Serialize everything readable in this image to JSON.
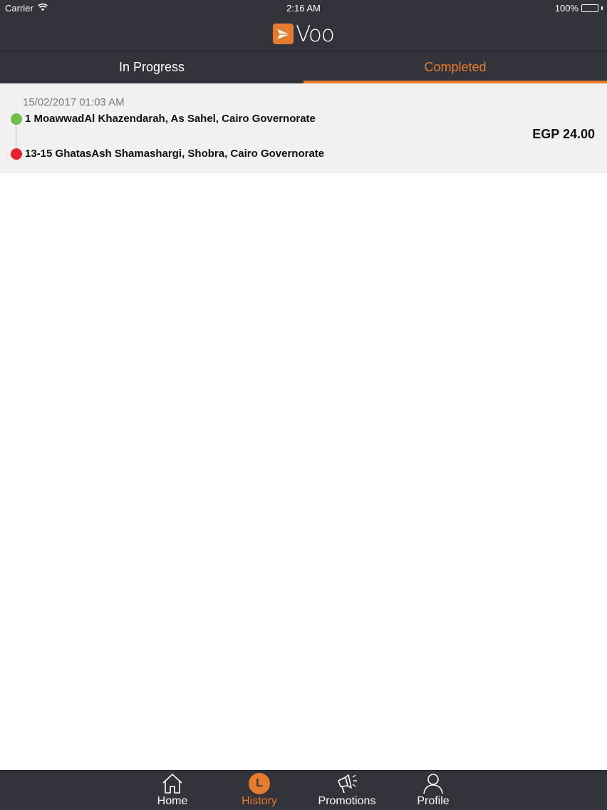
{
  "status_bar": {
    "carrier": "Carrier",
    "time": "2:16 AM",
    "battery": "100%"
  },
  "header": {
    "logo_text": "Voo"
  },
  "tabs": [
    {
      "label": "In Progress",
      "active": false
    },
    {
      "label": "Completed",
      "active": true
    }
  ],
  "rides": [
    {
      "date": "15/02/2017 01:03 AM",
      "pickup": "1 MoawwadAl Khazendarah, As Sahel, Cairo Governorate",
      "dropoff": "13-15 GhatasAsh Shamashargi, Shobra, Cairo Governorate",
      "fare": "EGP 24.00"
    }
  ],
  "tab_bar": {
    "items": [
      {
        "label": "Home",
        "icon": "home-icon",
        "active": false
      },
      {
        "label": "History",
        "icon": "history-icon",
        "icon_glyph": "L",
        "active": true
      },
      {
        "label": "Promotions",
        "icon": "megaphone-icon",
        "active": false
      },
      {
        "label": "Profile",
        "icon": "person-icon",
        "active": false
      }
    ]
  },
  "colors": {
    "accent": "#e57b2c",
    "bar_background": "#32333b",
    "pickup_pin": "#6cc04a",
    "dropoff_pin": "#e8202a",
    "row_background": "#f1f1f1"
  }
}
